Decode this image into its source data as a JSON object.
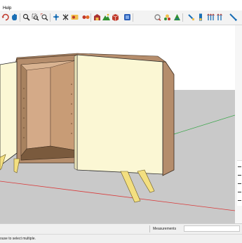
{
  "menu": {
    "help_label": "Help"
  },
  "toolbar": {
    "buttons": [
      {
        "icon": "orbit-icon",
        "color": "#c0392b"
      },
      {
        "icon": "pan-icon",
        "color": "#1a6fb5"
      },
      {
        "icon": "zoom-icon",
        "color": "#2d2d2d"
      },
      {
        "icon": "zoom-window-icon",
        "color": "#2d2d2d"
      },
      {
        "icon": "zoom-extents-icon",
        "color": "#2d2d2d"
      },
      {
        "icon": "previous-view-icon",
        "color": "#1a6fb5"
      },
      {
        "icon": "walk-icon",
        "color": "#2d2d2d"
      },
      {
        "icon": "position-camera-icon",
        "color": "#c0392b"
      },
      {
        "icon": "section-plane-icon",
        "color": "#c0392b"
      },
      {
        "icon": "add-location-icon",
        "color": "#a33"
      },
      {
        "icon": "terrain-icon",
        "color": "#2f8f2f"
      },
      {
        "icon": "warehouse-icon",
        "color": "#1a6fb5"
      },
      {
        "icon": "style-icon",
        "color": "#555555"
      },
      {
        "icon": "shadow-icon",
        "color": "#c0392b"
      },
      {
        "icon": "components-icon",
        "color": "#2f8f2f"
      },
      {
        "icon": "select-icon",
        "color": "#1a6fb5"
      },
      {
        "icon": "align-icon",
        "color": "#1a6fb5"
      },
      {
        "icon": "flip-icon",
        "color": "#1a6fb5"
      },
      {
        "icon": "distribute-icon",
        "color": "#1a6fb5"
      },
      {
        "icon": "measure-icon",
        "color": "#1a6fb5"
      }
    ]
  },
  "colors": {
    "door_panel": "#fbf7d4",
    "cabinet_wood": "#b58d6c",
    "cabinet_interior": "#d4aa88",
    "leg": "#f3df80",
    "ground": "#c9c9c9",
    "sky": "#ffffff",
    "axis_red": "#d93a3a",
    "axis_green": "#3aa64a"
  },
  "measurements": {
    "label": "Measurements",
    "value": ""
  },
  "status": {
    "hint": "ouse to select multiple."
  }
}
